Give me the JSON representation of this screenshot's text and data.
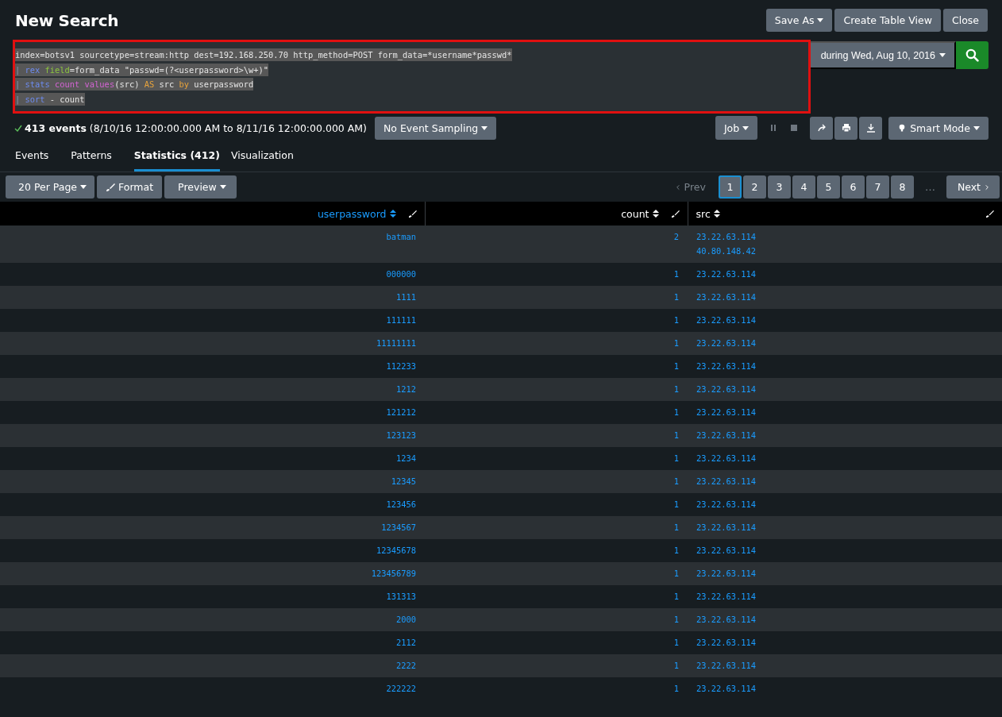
{
  "title": "New Search",
  "header_buttons": [
    {
      "label": "Save As",
      "caret": true
    },
    {
      "label": "Create Table View",
      "caret": false
    },
    {
      "label": "Close",
      "caret": false
    }
  ],
  "query": {
    "selected": true,
    "annotated": true,
    "lines": [
      [
        {
          "kind": "plain",
          "text": "index=botsv1 sourcetype=stream:http dest=192.168.250.70 http_method=POST form_data=*username*passwd*"
        }
      ],
      [
        {
          "kind": "pipe",
          "text": "| "
        },
        {
          "kind": "command",
          "text": "rex"
        },
        {
          "kind": "argument",
          "text": " field"
        },
        {
          "kind": "plain",
          "text": "=form_data \"passwd=(?<userpassword>\\w+)\""
        }
      ],
      [
        {
          "kind": "pipe",
          "text": "| "
        },
        {
          "kind": "command",
          "text": "stats"
        },
        {
          "kind": "function",
          "text": " count"
        },
        {
          "kind": "function",
          "text": " values"
        },
        {
          "kind": "plain",
          "text": "(src) "
        },
        {
          "kind": "keyword",
          "text": "AS"
        },
        {
          "kind": "plain",
          "text": " src "
        },
        {
          "kind": "keyword",
          "text": "by"
        },
        {
          "kind": "plain",
          "text": " userpassword"
        }
      ],
      [
        {
          "kind": "pipe",
          "text": "| "
        },
        {
          "kind": "command",
          "text": "sort"
        },
        {
          "kind": "plain",
          "text": " - count"
        }
      ]
    ]
  },
  "time_range": "during Wed, Aug 10, 2016",
  "status": {
    "events": "413 events",
    "range": "(8/10/16 12:00:00.000 AM to 8/11/16 12:00:00.000 AM)",
    "sampling": "No Event Sampling",
    "job": "Job",
    "mode": "Smart Mode"
  },
  "tabs": [
    {
      "label": "Events",
      "selected": false
    },
    {
      "label": "Patterns",
      "selected": false
    },
    {
      "label": "Statistics (412)",
      "selected": true
    },
    {
      "label": "Visualization",
      "selected": false
    }
  ],
  "toolbar": [
    {
      "label": "20 Per Page",
      "kind": "dropdown"
    },
    {
      "label": "Format",
      "kind": "format"
    },
    {
      "label": "Preview",
      "kind": "dropdown"
    }
  ],
  "pagination": {
    "prev": "Prev",
    "next": "Next",
    "ellipsis": "…",
    "pages": [
      {
        "label": "1",
        "selected": true
      },
      {
        "label": "2",
        "selected": false
      },
      {
        "label": "3",
        "selected": false
      },
      {
        "label": "4",
        "selected": false
      },
      {
        "label": "5",
        "selected": false
      },
      {
        "label": "6",
        "selected": false
      },
      {
        "label": "7",
        "selected": false
      },
      {
        "label": "8",
        "selected": false
      }
    ]
  },
  "table": {
    "columns": [
      {
        "label": "userpassword",
        "sorted": true
      },
      {
        "label": "count",
        "sorted": false
      },
      {
        "label": "src",
        "sorted": false
      }
    ],
    "rows": [
      {
        "userpassword": "batman",
        "count": "2",
        "src": [
          "23.22.63.114",
          "40.80.148.42"
        ]
      },
      {
        "userpassword": "000000",
        "count": "1",
        "src": [
          "23.22.63.114"
        ]
      },
      {
        "userpassword": "1111",
        "count": "1",
        "src": [
          "23.22.63.114"
        ]
      },
      {
        "userpassword": "111111",
        "count": "1",
        "src": [
          "23.22.63.114"
        ]
      },
      {
        "userpassword": "11111111",
        "count": "1",
        "src": [
          "23.22.63.114"
        ]
      },
      {
        "userpassword": "112233",
        "count": "1",
        "src": [
          "23.22.63.114"
        ]
      },
      {
        "userpassword": "1212",
        "count": "1",
        "src": [
          "23.22.63.114"
        ]
      },
      {
        "userpassword": "121212",
        "count": "1",
        "src": [
          "23.22.63.114"
        ]
      },
      {
        "userpassword": "123123",
        "count": "1",
        "src": [
          "23.22.63.114"
        ]
      },
      {
        "userpassword": "1234",
        "count": "1",
        "src": [
          "23.22.63.114"
        ]
      },
      {
        "userpassword": "12345",
        "count": "1",
        "src": [
          "23.22.63.114"
        ]
      },
      {
        "userpassword": "123456",
        "count": "1",
        "src": [
          "23.22.63.114"
        ]
      },
      {
        "userpassword": "1234567",
        "count": "1",
        "src": [
          "23.22.63.114"
        ]
      },
      {
        "userpassword": "12345678",
        "count": "1",
        "src": [
          "23.22.63.114"
        ]
      },
      {
        "userpassword": "123456789",
        "count": "1",
        "src": [
          "23.22.63.114"
        ]
      },
      {
        "userpassword": "131313",
        "count": "1",
        "src": [
          "23.22.63.114"
        ]
      },
      {
        "userpassword": "2000",
        "count": "1",
        "src": [
          "23.22.63.114"
        ]
      },
      {
        "userpassword": "2112",
        "count": "1",
        "src": [
          "23.22.63.114"
        ]
      },
      {
        "userpassword": "2222",
        "count": "1",
        "src": [
          "23.22.63.114"
        ]
      },
      {
        "userpassword": "222222",
        "count": "1",
        "src": [
          "23.22.63.114"
        ]
      }
    ]
  }
}
